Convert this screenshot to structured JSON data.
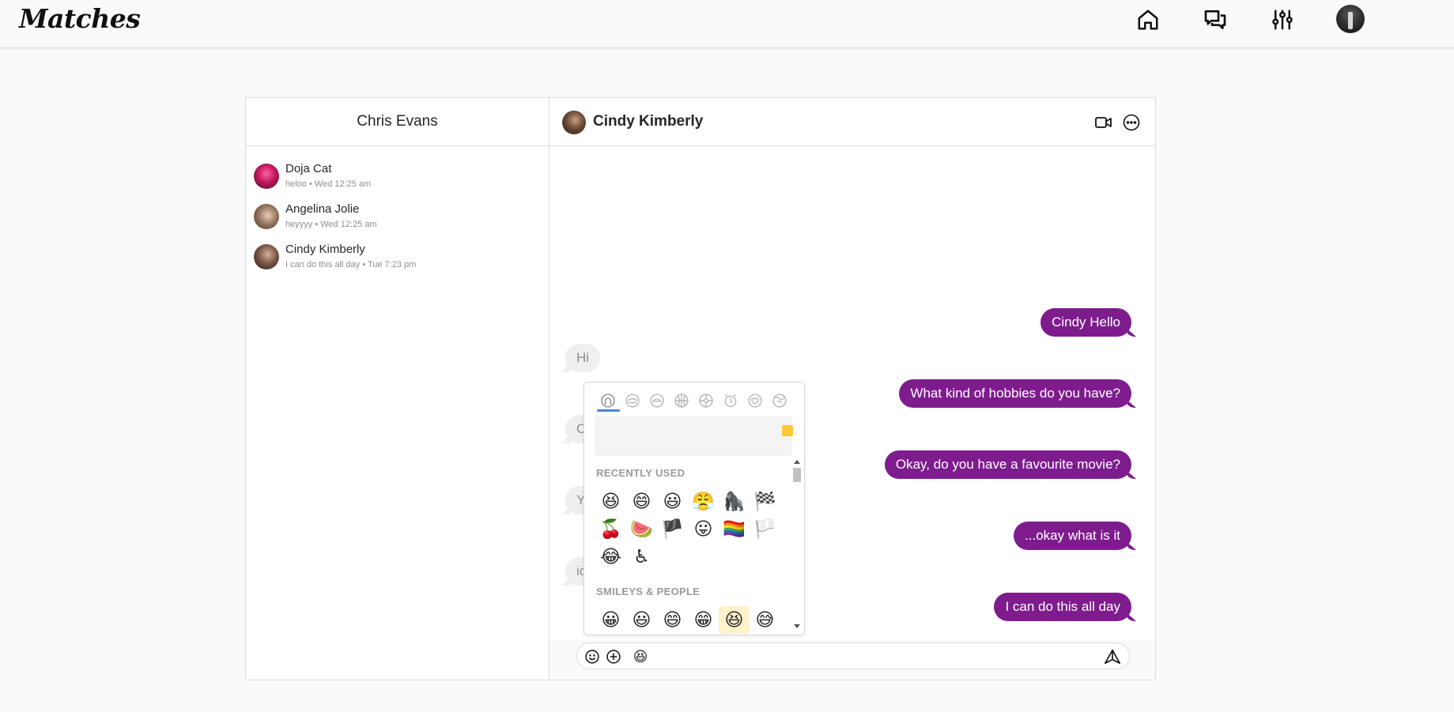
{
  "app": {
    "logo": "Matches"
  },
  "nav": {
    "icons": [
      "home-icon",
      "messages-icon",
      "filters-icon",
      "profile-avatar"
    ]
  },
  "sidebar": {
    "title": "Chris Evans",
    "conversations": [
      {
        "name": "Doja Cat",
        "preview": "heloo",
        "time": "Wed 12:25 am",
        "sep": "•"
      },
      {
        "name": "Angelina Jolie",
        "preview": "heyyyy",
        "time": "Wed 12:25 am",
        "sep": "•"
      },
      {
        "name": "Cindy Kimberly",
        "preview": "I can do this all day",
        "time": "Tue 7:23 pm",
        "sep": "•"
      }
    ]
  },
  "chat": {
    "contact_name": "Cindy Kimberly",
    "messages": [
      {
        "direction": "out",
        "text": "Cindy Hello"
      },
      {
        "direction": "in",
        "text": "Hi"
      },
      {
        "direction": "out",
        "text": "What kind of hobbies do you have?"
      },
      {
        "direction": "in",
        "text": "C"
      },
      {
        "direction": "out",
        "text": "Okay, do you have a favourite movie?"
      },
      {
        "direction": "in",
        "text": "Y"
      },
      {
        "direction": "out",
        "text": "...okay what is it"
      },
      {
        "direction": "in",
        "text": "ic"
      },
      {
        "direction": "out",
        "text": "I can do this all day"
      }
    ]
  },
  "composer": {
    "value": "",
    "selected_emoji": "😆"
  },
  "emoji_picker": {
    "categories": [
      "people",
      "nature",
      "food",
      "activity",
      "travel",
      "objects",
      "symbols",
      "flags"
    ],
    "active_category": "people",
    "search": {
      "value": "",
      "placeholder": ""
    },
    "recently_used_title": "RECENTLY USED",
    "recently_used": [
      "😆",
      "😄",
      "😃",
      "😤",
      "🦍",
      "🏁",
      "🍒",
      "🍉",
      "🏴",
      "😛",
      "🏳️‍🌈",
      "🏳️",
      "😂",
      "♿"
    ],
    "smileys_title": "SMILEYS & PEOPLE",
    "smileys": [
      "😀",
      "😃",
      "😄",
      "😁",
      "😆",
      "😅"
    ],
    "highlighted": "😆"
  },
  "colors": {
    "accent": "#7e1c8e",
    "incoming": "#efefef",
    "tab_underline": "#4b86d8"
  }
}
